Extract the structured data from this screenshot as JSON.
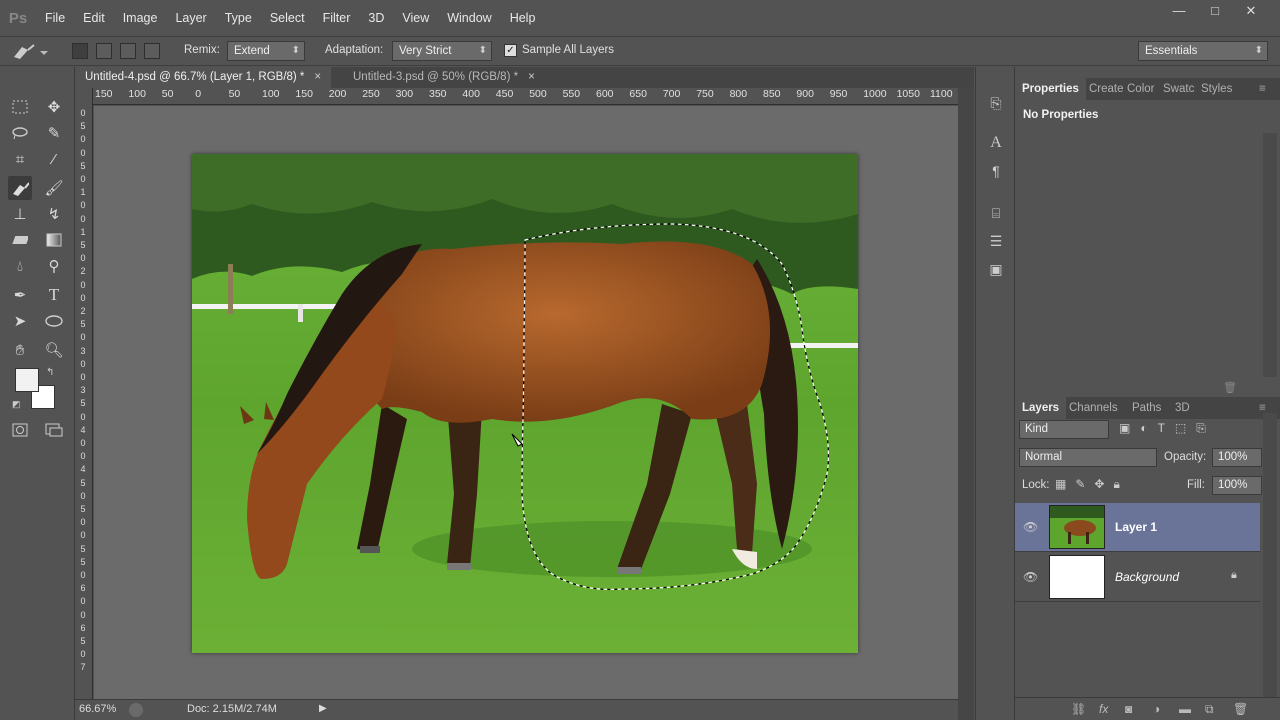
{
  "app": {
    "logo": "Ps"
  },
  "menu": [
    "File",
    "Edit",
    "Image",
    "Layer",
    "Type",
    "Select",
    "Filter",
    "3D",
    "View",
    "Window",
    "Help"
  ],
  "window_controls": {
    "minimize": "—",
    "maximize": "□",
    "close": "✕"
  },
  "options": {
    "remix_label": "Remix:",
    "remix_value": "Extend",
    "adaptation_label": "Adaptation:",
    "adaptation_value": "Very Strict",
    "sample_all_label": "Sample All Layers",
    "sample_all_checked": "✓",
    "workspace": "Essentials"
  },
  "tabs": [
    {
      "label": "Untitled-4.psd @ 66.7% (Layer 1, RGB/8) *",
      "close": "×"
    },
    {
      "label": "Untitled-3.psd @ 50% (RGB/8) *",
      "close": "×"
    }
  ],
  "ruler_h": [
    "150",
    "100",
    "50",
    "0",
    "50",
    "100",
    "150",
    "200",
    "250",
    "300",
    "350",
    "400",
    "450",
    "500",
    "550",
    "600",
    "650",
    "700",
    "750",
    "800",
    "850",
    "900",
    "950",
    "1000",
    "1050",
    "1100"
  ],
  "ruler_v": [
    "0",
    "5",
    "0",
    "0",
    "5",
    "0",
    "1",
    "0",
    "0",
    "1",
    "5",
    "0",
    "2",
    "0",
    "0",
    "2",
    "5",
    "0",
    "3",
    "0",
    "0",
    "3",
    "5",
    "0",
    "4",
    "0",
    "0",
    "4",
    "5",
    "0",
    "5",
    "0",
    "0",
    "5",
    "5",
    "0",
    "6",
    "0",
    "0",
    "6",
    "5",
    "0",
    "7"
  ],
  "status": {
    "zoom": "66.67%",
    "doc": "Doc: 2.15M/2.74M",
    "arrow": "▶"
  },
  "properties": {
    "tabs": [
      "Properties",
      "Create",
      "Color",
      "Swatc",
      "Styles"
    ],
    "content": "No Properties"
  },
  "layers_panel": {
    "tabs": [
      "Layers",
      "Channels",
      "Paths",
      "3D"
    ],
    "kind": "Kind",
    "blend": "Normal",
    "opacity_label": "Opacity:",
    "opacity": "100%",
    "lock_label": "Lock:",
    "fill_label": "Fill:",
    "fill": "100%",
    "layers": [
      {
        "name": "Layer 1"
      },
      {
        "name": "Background"
      }
    ],
    "bottom_icons": [
      "link-icon",
      "fx-icon",
      "mask-icon",
      "adjustment-icon",
      "folder-icon",
      "new-layer-icon",
      "trash-icon"
    ]
  },
  "colors": {
    "ui_bg": "#535353",
    "selected_layer": "#6a7499",
    "canvas_bg": "#6b6b6b"
  }
}
